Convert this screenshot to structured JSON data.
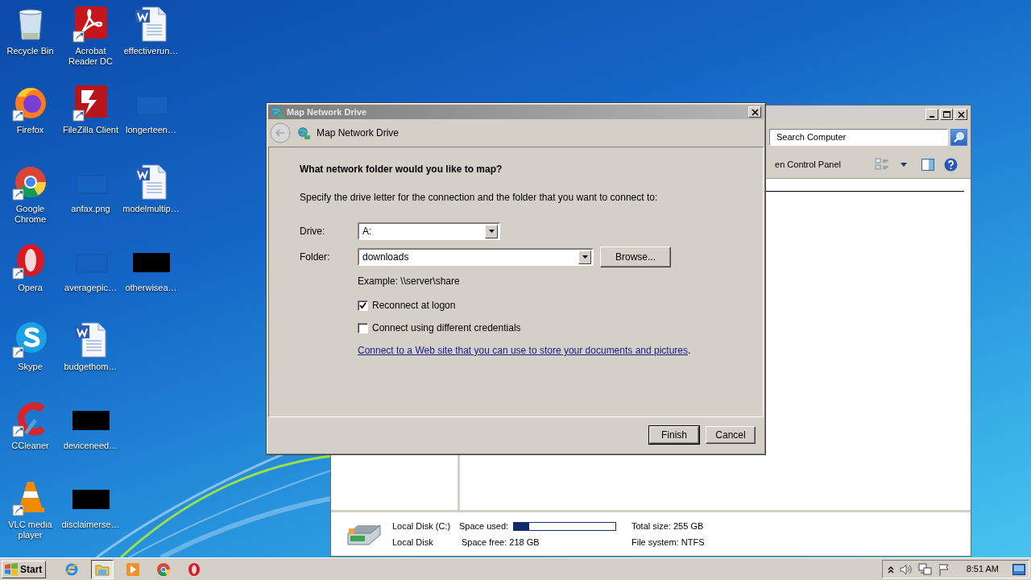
{
  "desktop_icons": [
    {
      "label": "Recycle Bin",
      "kind": "bin",
      "shortcut": false
    },
    {
      "label": "Firefox",
      "kind": "firefox",
      "shortcut": true
    },
    {
      "label": "Google Chrome",
      "kind": "chrome",
      "shortcut": true
    },
    {
      "label": "Opera",
      "kind": "opera",
      "shortcut": true
    },
    {
      "label": "Skype",
      "kind": "skype",
      "shortcut": true
    },
    {
      "label": "CCleaner",
      "kind": "ccleaner",
      "shortcut": true
    },
    {
      "label": "VLC media player",
      "kind": "vlc",
      "shortcut": true
    },
    {
      "label": "Acrobat Reader DC",
      "kind": "acrobat",
      "shortcut": true
    },
    {
      "label": "FileZilla Client",
      "kind": "filezilla",
      "shortcut": true
    },
    {
      "label": "anfax.png",
      "kind": "blank",
      "shortcut": false
    },
    {
      "label": "averagepic…",
      "kind": "blank",
      "shortcut": false
    },
    {
      "label": "budgethom…",
      "kind": "word",
      "shortcut": false
    },
    {
      "label": "deviceneed…",
      "kind": "black",
      "shortcut": false
    },
    {
      "label": "disclaimerse…",
      "kind": "black",
      "shortcut": false
    },
    {
      "label": "effectiverun…",
      "kind": "word",
      "shortcut": false
    },
    {
      "label": "longerteen…",
      "kind": "blank",
      "shortcut": false
    },
    {
      "label": "modelmultip…",
      "kind": "word",
      "shortcut": false
    },
    {
      "label": "otherwisea…",
      "kind": "black",
      "shortcut": false
    }
  ],
  "explorer": {
    "search": {
      "placeholder": "Search Computer"
    },
    "toolbar_command": "en Control Panel",
    "drive": {
      "name": "Local Disk (C:)",
      "type": "Local Disk",
      "space_used_label": "Space used:",
      "level": 0.15,
      "space_free_label": "Space free:",
      "space_free": "218 GB",
      "total_size_label": "Total size:",
      "total_size": "255 GB",
      "file_system_label": "File system:",
      "file_system": "NTFS"
    }
  },
  "dialog": {
    "title": "Map Network Drive",
    "header": "Map Network Drive",
    "question": "What network folder would you like to map?",
    "instruction": "Specify the drive letter for the connection and the folder that you want to connect to:",
    "fields": [
      {
        "label": "Drive:",
        "value": "A:"
      },
      {
        "label": "Folder:",
        "value": "downloads",
        "button": "Browse..."
      }
    ],
    "example": "Example: \\\\server\\share",
    "options": [
      {
        "label": "Reconnect at logon",
        "checked": true
      },
      {
        "label": "Connect using different credentials",
        "checked": false
      }
    ],
    "link": {
      "text": "Connect to a Web site that you can use to store your documents and pictures",
      "after": "."
    },
    "buttons": [
      {
        "label": "Finish",
        "default": true
      },
      {
        "label": "Cancel",
        "default": false
      }
    ]
  },
  "taskbar": {
    "start": "Start",
    "apps": [
      {
        "kind": "ie",
        "selected": false
      },
      {
        "kind": "explorer",
        "selected": true
      },
      {
        "kind": "media",
        "selected": false
      },
      {
        "kind": "chrome",
        "selected": false
      },
      {
        "kind": "opera",
        "selected": false
      }
    ],
    "clock": "8:51 AM"
  }
}
